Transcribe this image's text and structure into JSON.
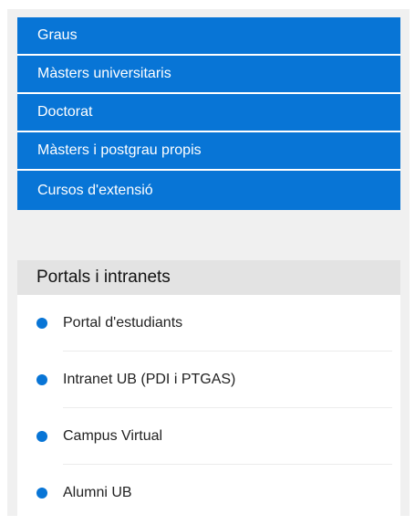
{
  "study_nav": {
    "items": [
      {
        "label": "Graus"
      },
      {
        "label": "Màsters universitaris"
      },
      {
        "label": "Doctorat"
      },
      {
        "label": "Màsters i postgrau propis"
      },
      {
        "label": "Cursos d'extensió"
      }
    ]
  },
  "portals": {
    "title": "Portals i intranets",
    "items": [
      {
        "label": "Portal d'estudiants"
      },
      {
        "label": "Intranet UB (PDI i PTGAS)"
      },
      {
        "label": "Campus Virtual"
      },
      {
        "label": "Alumni UB"
      }
    ]
  },
  "colors": {
    "accent": "#0875d6",
    "panel_bg": "#f0f0f0",
    "header_bg": "#e3e3e3"
  }
}
